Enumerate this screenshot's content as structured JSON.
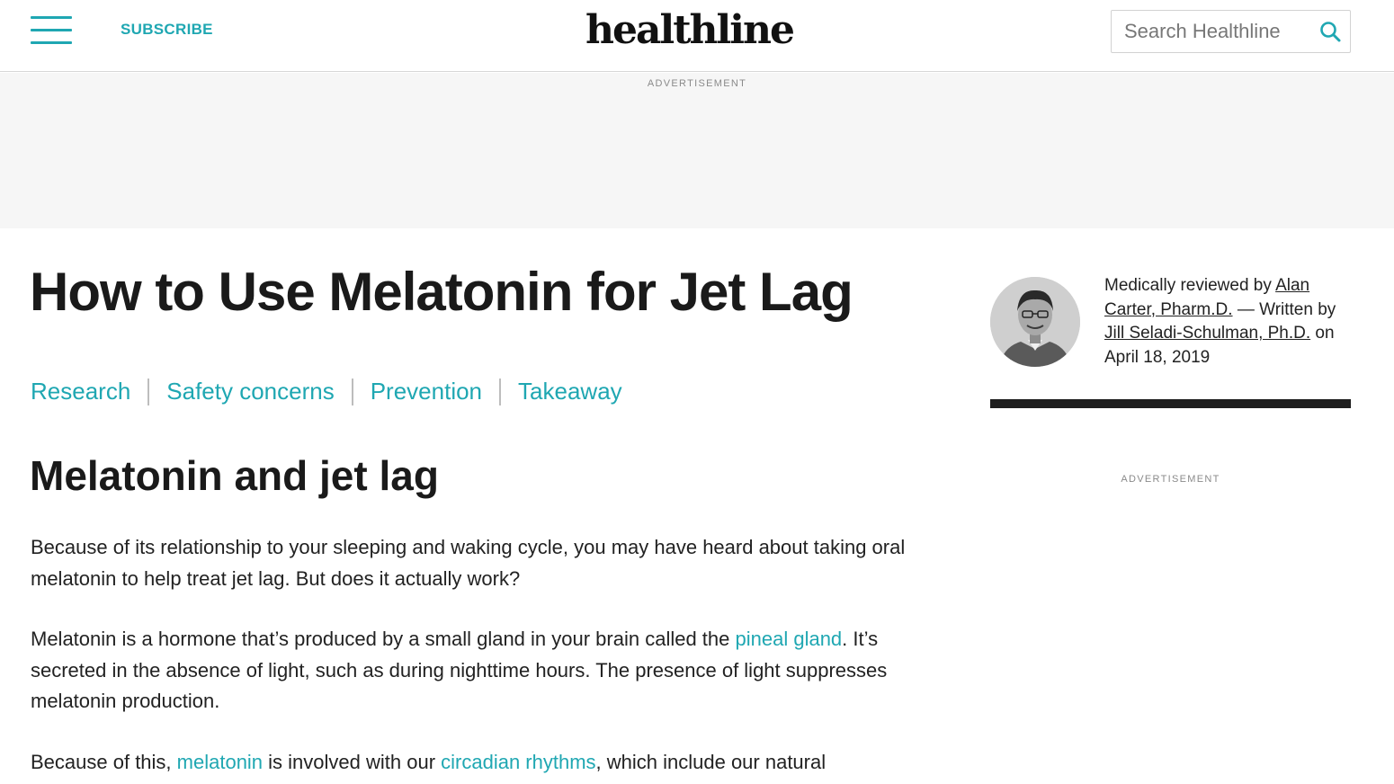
{
  "header": {
    "subscribe_label": "SUBSCRIBE",
    "logo_text": "healthline",
    "search_placeholder": "Search Healthline"
  },
  "ads": {
    "top_label": "ADVERTISEMENT",
    "sidebar_label": "ADVERTISEMENT"
  },
  "article": {
    "title": "How to Use Melatonin for Jet Lag",
    "toc": [
      "Research",
      "Safety concerns",
      "Prevention",
      "Takeaway"
    ],
    "section_heading": "Melatonin and jet lag",
    "p1": "Because of its relationship to your sleeping and waking cycle, you may have heard about taking oral melatonin to help treat jet lag. But does it actually work?",
    "p2": {
      "before": "Melatonin is a hormone that’s produced by a small gland in your brain called the ",
      "link": "pineal gland",
      "after": ". It’s secreted in the absence of light, such as during nighttime hours. The presence of light suppresses melatonin production."
    },
    "p3": {
      "before": "Because of this, ",
      "link1": "melatonin",
      "middle": " is involved with our ",
      "link2": "circadian rhythms",
      "after": ", which include our natural"
    }
  },
  "byline": {
    "reviewed_prefix": "Medically reviewed by ",
    "reviewer": "Alan Carter, Pharm.D.",
    "written_prefix": " — Written by ",
    "author": "Jill Seladi-Schulman, Ph.D.",
    "date_text": " on April 18, 2019"
  },
  "colors": {
    "accent": "#1fa7b2",
    "text": "#222222",
    "ad_background": "#f6f6f6",
    "divider_bar": "#1e1e1e"
  },
  "icons": {
    "menu": "hamburger-icon",
    "search": "search-icon"
  }
}
